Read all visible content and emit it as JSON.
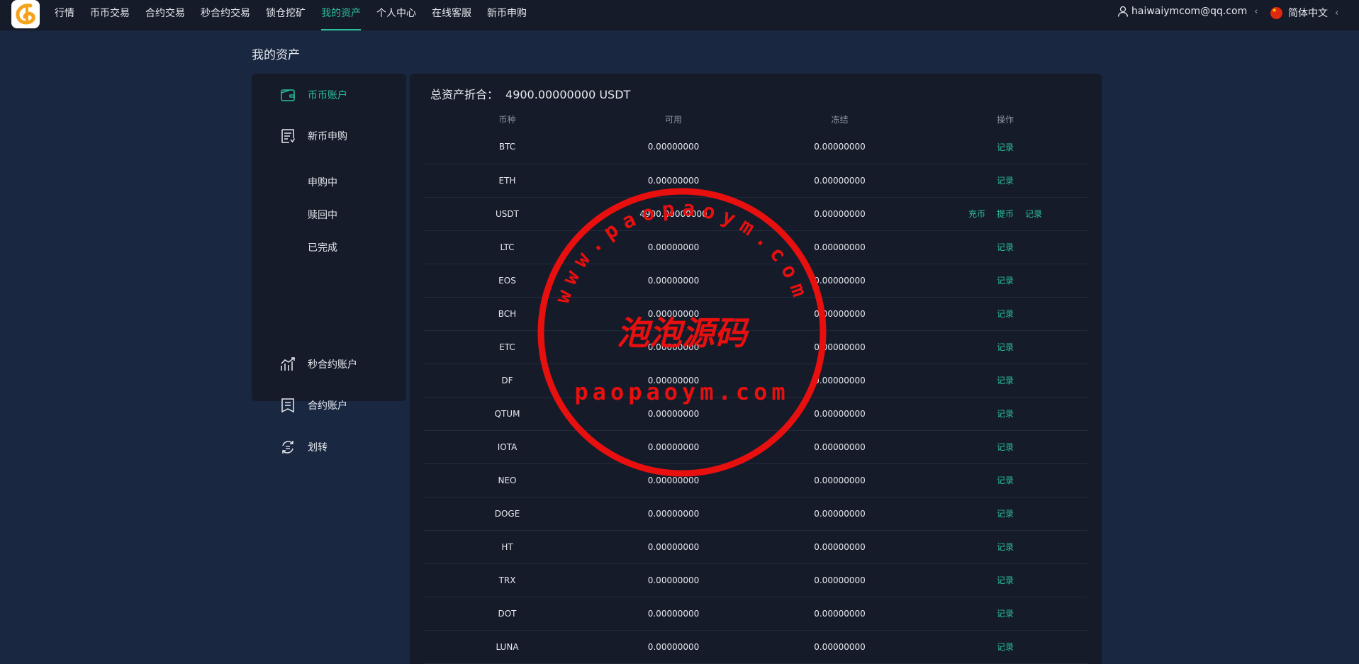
{
  "nav": {
    "items": [
      "行情",
      "币币交易",
      "合约交易",
      "秒合约交易",
      "锁仓挖矿",
      "我的资产",
      "个人中心",
      "在线客服",
      "新币申购"
    ],
    "active_index": 5,
    "user_email": "haiwaiymcom@qq.com",
    "language": "简体中文"
  },
  "page": {
    "title": "我的资产"
  },
  "sidebar": {
    "items": [
      {
        "label": "币币账户",
        "icon": "wallet-icon"
      },
      {
        "label": "新币申购",
        "icon": "receipt-icon"
      },
      {
        "label": "秒合约账户",
        "icon": "chart-icon"
      },
      {
        "label": "合约账户",
        "icon": "document-icon"
      },
      {
        "label": "划转",
        "icon": "transfer-icon"
      }
    ],
    "sub_items": [
      "申购中",
      "赎回中",
      "已完成"
    ],
    "active": "币币账户"
  },
  "summary": {
    "label": "总资产折合：",
    "value": "4900.00000000 USDT"
  },
  "table": {
    "headers": [
      "币种",
      "可用",
      "冻结",
      "操作"
    ],
    "rows": [
      {
        "coin": "BTC",
        "available": "0.00000000",
        "frozen": "0.00000000",
        "actions": [
          "记录"
        ]
      },
      {
        "coin": "ETH",
        "available": "0.00000000",
        "frozen": "0.00000000",
        "actions": [
          "记录"
        ]
      },
      {
        "coin": "USDT",
        "available": "4900.00000000",
        "frozen": "0.00000000",
        "actions": [
          "充币",
          "提币",
          "记录"
        ]
      },
      {
        "coin": "LTC",
        "available": "0.00000000",
        "frozen": "0.00000000",
        "actions": [
          "记录"
        ]
      },
      {
        "coin": "EOS",
        "available": "0.00000000",
        "frozen": "0.00000000",
        "actions": [
          "记录"
        ]
      },
      {
        "coin": "BCH",
        "available": "0.00000000",
        "frozen": "0.00000000",
        "actions": [
          "记录"
        ]
      },
      {
        "coin": "ETC",
        "available": "0.00000000",
        "frozen": "0.00000000",
        "actions": [
          "记录"
        ]
      },
      {
        "coin": "DF",
        "available": "0.00000000",
        "frozen": "0.00000000",
        "actions": [
          "记录"
        ]
      },
      {
        "coin": "QTUM",
        "available": "0.00000000",
        "frozen": "0.00000000",
        "actions": [
          "记录"
        ]
      },
      {
        "coin": "IOTA",
        "available": "0.00000000",
        "frozen": "0.00000000",
        "actions": [
          "记录"
        ]
      },
      {
        "coin": "NEO",
        "available": "0.00000000",
        "frozen": "0.00000000",
        "actions": [
          "记录"
        ]
      },
      {
        "coin": "DOGE",
        "available": "0.00000000",
        "frozen": "0.00000000",
        "actions": [
          "记录"
        ]
      },
      {
        "coin": "HT",
        "available": "0.00000000",
        "frozen": "0.00000000",
        "actions": [
          "记录"
        ]
      },
      {
        "coin": "TRX",
        "available": "0.00000000",
        "frozen": "0.00000000",
        "actions": [
          "记录"
        ]
      },
      {
        "coin": "DOT",
        "available": "0.00000000",
        "frozen": "0.00000000",
        "actions": [
          "记录"
        ]
      },
      {
        "coin": "LUNA",
        "available": "0.00000000",
        "frozen": "0.00000000",
        "actions": [
          "记录"
        ]
      }
    ]
  },
  "watermark": {
    "arc_text": "www.paopaoym.com",
    "center_text": "泡泡源码",
    "bottom_text": "paopaoym.com",
    "color": "#e8100f"
  },
  "colors": {
    "accent": "#2bc09a",
    "background": "#1a2740",
    "panel": "#151b29"
  }
}
